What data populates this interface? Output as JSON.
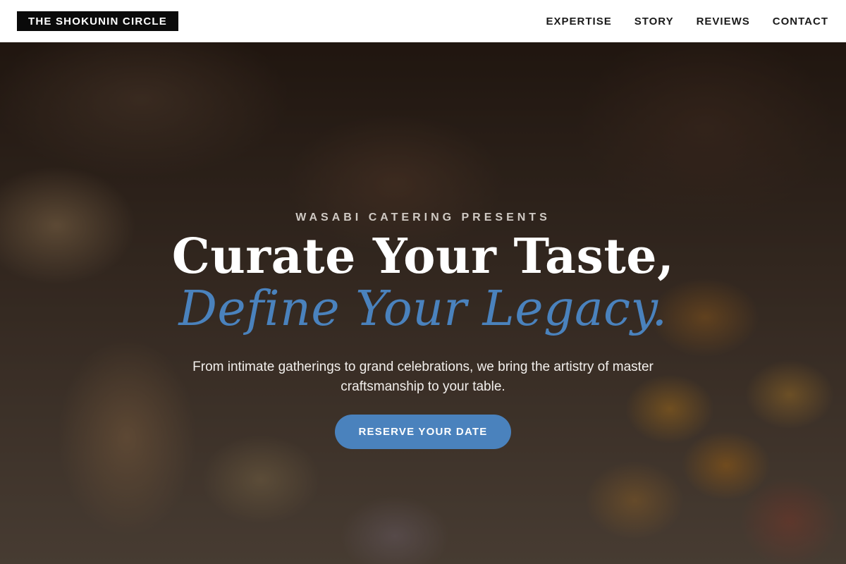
{
  "nav": {
    "logo": "THE SHOKUNIN CIRCLE",
    "links": [
      "EXPERTISE",
      "STORY",
      "REVIEWS",
      "CONTACT"
    ]
  },
  "hero": {
    "eyebrow": "WASABI CATERING PRESENTS",
    "headline": "Curate Your Taste,",
    "headline_accent": "Define Your Legacy.",
    "subtext": "From intimate gatherings to grand celebrations, we bring the artistry of master craftsmanship to your table.",
    "cta_label": "RESERVE YOUR DATE"
  },
  "colors": {
    "accent": "#4a82bd",
    "logo_bg": "#0a0a0a",
    "nav_bg": "#ffffff"
  }
}
